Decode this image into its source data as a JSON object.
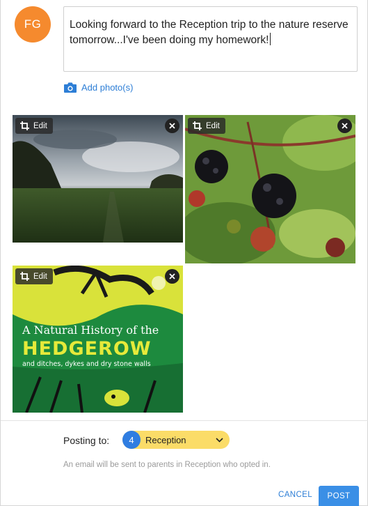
{
  "author": {
    "initials": "FG",
    "avatar_color": "#f58a2e"
  },
  "composer": {
    "text": "Looking forward to the Reception trip to the nature reserve tomorrow...I've been doing my homework!"
  },
  "add_photo": {
    "label": "Add photo(s)",
    "icon": "camera-icon"
  },
  "photos": [
    {
      "edit_label": "Edit",
      "subject": "cloudy sky over green field"
    },
    {
      "edit_label": "Edit",
      "subject": "blackberries on bramble"
    },
    {
      "edit_label": "Edit",
      "subject": "book cover"
    }
  ],
  "book_cover": {
    "line1": "A Natural History of the",
    "line2": "HEDGEROW",
    "line3": "and ditches, dykes and dry stone walls"
  },
  "posting": {
    "label": "Posting to:",
    "count": "4",
    "audience": "Reception",
    "notice": "An email will be sent to parents in Reception who opted in."
  },
  "actions": {
    "cancel": "CANCEL",
    "post": "POST"
  },
  "colors": {
    "accent": "#2f7de1",
    "audience_pill": "#fbdc68",
    "post_button": "#3a8fe6"
  }
}
